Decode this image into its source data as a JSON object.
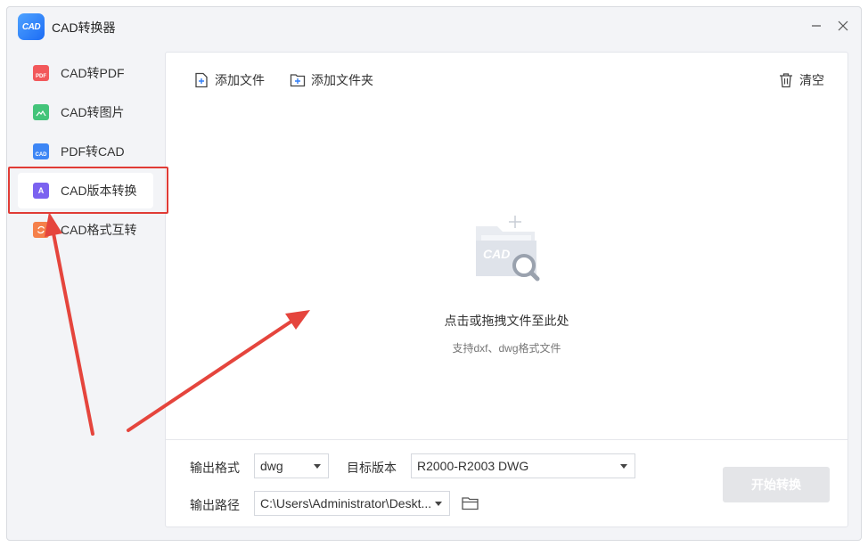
{
  "app": {
    "title": "CAD转换器",
    "logo_text": "CAD",
    "minimize_icon": "minimize-icon",
    "close_icon": "close-icon"
  },
  "sidebar": {
    "items": [
      {
        "label": "CAD转PDF",
        "icon": "pdf-file-icon",
        "icon_text": "PDF",
        "color": "#f2585b",
        "active": false
      },
      {
        "label": "CAD转图片",
        "icon": "image-file-icon",
        "icon_text": "",
        "color": "#43c47a",
        "active": false
      },
      {
        "label": "PDF转CAD",
        "icon": "cad-file-icon",
        "icon_text": "CAD",
        "color": "#3d86f5",
        "active": false
      },
      {
        "label": "CAD版本转换",
        "icon": "version-file-icon",
        "icon_text": "A",
        "color": "#7b62f0",
        "active": true
      },
      {
        "label": "CAD格式互转",
        "icon": "format-convert-icon",
        "icon_text": "",
        "color": "#f5804a",
        "active": false
      }
    ]
  },
  "toolbar": {
    "add_file": "添加文件",
    "add_folder": "添加文件夹",
    "clear": "清空"
  },
  "drop_zone": {
    "illustration_text": "CAD",
    "title": "点击或拖拽文件至此处",
    "subtitle": "支持dxf、dwg格式文件"
  },
  "bottom": {
    "output_format_label": "输出格式",
    "output_format_value": "dwg",
    "target_version_label": "目标版本",
    "target_version_value": "R2000-R2003 DWG",
    "output_path_label": "输出路径",
    "output_path_value": "C:\\Users\\Administrator\\Deskt...",
    "start_button": "开始转换"
  },
  "annotation": {
    "highlight_color": "#e03b35"
  }
}
